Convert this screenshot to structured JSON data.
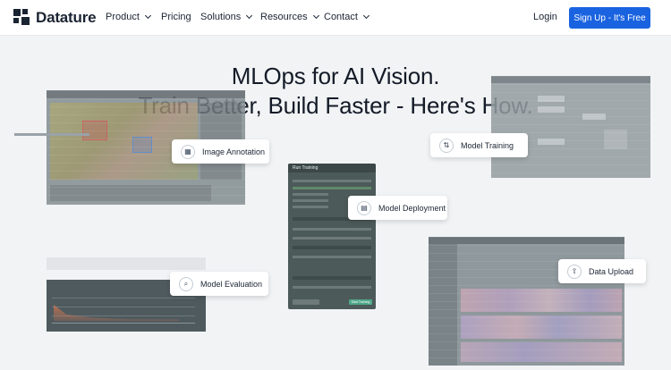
{
  "nav": {
    "logo_text": "Datature",
    "items": [
      {
        "label": "Product"
      },
      {
        "label": "Pricing"
      },
      {
        "label": "Solutions"
      },
      {
        "label": "Resources"
      },
      {
        "label": "Contact"
      }
    ],
    "login_label": "Login",
    "signup_label": "Sign Up - It's Free"
  },
  "hero": {
    "line1": "MLOps for AI Vision.",
    "line2": "Train Better, Build Faster - Here's How."
  },
  "features": [
    {
      "label": "Image Annotation",
      "icon": "grid-icon"
    },
    {
      "label": "Model Training",
      "icon": "swap-icon"
    },
    {
      "label": "Model Deployment",
      "icon": "document-icon"
    },
    {
      "label": "Model Evaluation",
      "icon": "magnifier-icon"
    },
    {
      "label": "Data Upload",
      "icon": "upload-icon"
    }
  ],
  "run_panel": {
    "title": "Run Training",
    "start_label": "Start Training"
  },
  "colors": {
    "accent": "#1a63e0",
    "text": "#141b27",
    "panel": "#8a9398",
    "background": "#f1f3f5"
  }
}
